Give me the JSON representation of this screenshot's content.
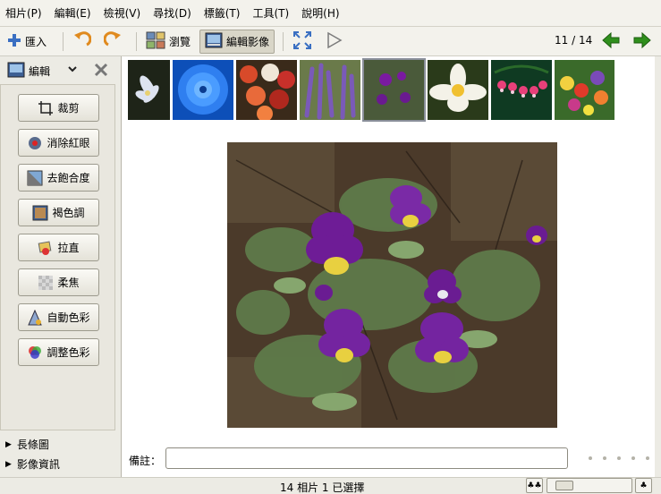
{
  "menubar": {
    "items": [
      "相片(P)",
      "編輯(E)",
      "檢視(V)",
      "尋找(D)",
      "標籤(T)",
      "工具(T)",
      "說明(H)"
    ]
  },
  "toolbar": {
    "import_label": "匯入",
    "browse_label": "瀏覽",
    "edit_label": "編輯影像",
    "page_current": "11",
    "page_total": "14",
    "page_text": "11 / 14",
    "icons": [
      "plus-icon",
      "rotate-left-icon",
      "rotate-right-icon",
      "browse-icon",
      "edit-image-icon",
      "fullscreen-icon",
      "slideshow-play-icon",
      "arrow-left-icon",
      "arrow-right-icon"
    ]
  },
  "sidebar": {
    "header": {
      "label": "編輯"
    },
    "tools": [
      {
        "label": "裁剪",
        "icon": "crop-icon"
      },
      {
        "label": "消除紅眼",
        "icon": "red-eye-icon"
      },
      {
        "label": "去飽合度",
        "icon": "desaturate-icon"
      },
      {
        "label": "褐色調",
        "icon": "sepia-icon"
      },
      {
        "label": "拉直",
        "icon": "straighten-icon"
      },
      {
        "label": "柔焦",
        "icon": "soft-focus-icon"
      },
      {
        "label": "自動色彩",
        "icon": "auto-color-icon"
      },
      {
        "label": "調整色彩",
        "icon": "adjust-color-icon"
      }
    ],
    "expanders": [
      {
        "label": "長條圖"
      },
      {
        "label": "影像資訊"
      }
    ]
  },
  "main": {
    "notes_label": "備註："
  },
  "statusbar": {
    "text": "14 相片  1 已選擇",
    "zoom_level": 0.1
  },
  "colors": {
    "window_bg": "#ecebe4",
    "toolbar_bg": "#f3f2ec",
    "arrow_green": "#2f8f1c",
    "accent_blue": "#3a6fc2"
  }
}
